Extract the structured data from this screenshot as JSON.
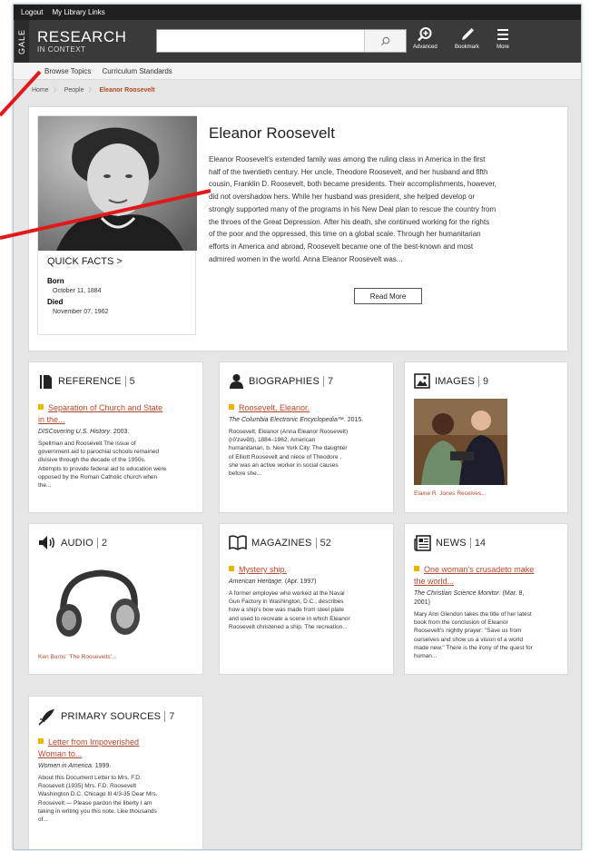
{
  "topbar": {
    "logout": "Logout",
    "library_links": "My Library Links"
  },
  "header": {
    "gale": "GALE",
    "brand_title": "RESEARCH",
    "brand_subtitle": "IN CONTEXT",
    "search_placeholder": "",
    "advanced": "Advanced",
    "bookmark": "Bookmark",
    "more": "More"
  },
  "subnav": {
    "browse": "Browse Topics",
    "standards": "Curriculum Standards"
  },
  "breadcrumb": {
    "home": "Home",
    "people": "People",
    "current": "Eleanor Roosevelt"
  },
  "hero": {
    "title": "Eleanor Roosevelt",
    "bio_lines": [
      "Eleanor Roosevelt's extended family was among the ruling class in America in the first",
      "half of the twentieth century. Her uncle, Theodore Roosevelt, and her husband and fifth",
      "cousin, Franklin D. Roosevelt, both became presidents. Their accomplishments, however,",
      "did not overshadow hers. While her husband was president, she helped develop or",
      "strongly supported many of the programs in his New Deal plan to rescue the country from",
      "the throes of the Great Depression. After his death, she continued working for the rights",
      "of the poor and the oppressed, this time on a global scale. Through her humanitarian",
      "efforts in America and abroad, Roosevelt became one of the best-known and most",
      "admired women in the world. Anna Eleanor Roosevelt was..."
    ],
    "read_more": "Read More",
    "quick_facts": "QUICK FACTS >",
    "born_label": "Born",
    "born_value": "October 11, 1884",
    "died_label": "Died",
    "died_value": "November 07, 1962"
  },
  "cards": {
    "reference": {
      "label": "REFERENCE",
      "count": "5",
      "link1": "Separation of Church and State",
      "link2": "in the...",
      "source_title": "DISCovering U.S. History",
      "source_rest": ". 2003.",
      "snippet": [
        "Spellman and Roosevelt The issue of",
        "government aid to parochial schools remained",
        "divisive through the decade of the 1950s.",
        "Attempts to provide federal aid to education were",
        "opposed by the Roman Catholic church when",
        "the..."
      ]
    },
    "biographies": {
      "label": "BIOGRAPHIES",
      "count": "7",
      "link1": "Roosevelt, Eleanor.",
      "source_title": "The Columbia Electronic Encyclopedia™",
      "source_rest": ". 2015.",
      "snippet": [
        "Roosevelt, Eleanor (Anna Eleanor Roosevelt)",
        "(rō'zəvĕlt), 1884–1962, American",
        "humanitarian, b. New York City. The daughter",
        "of Elliott Roosevelt and niece of Theodore ,",
        "she was an active worker in social causes",
        "before she..."
      ]
    },
    "images": {
      "label": "IMAGES",
      "count": "9",
      "caption": "Elaine R. Jones Receives..."
    },
    "audio": {
      "label": "AUDIO",
      "count": "2",
      "caption": "Ken Burns' 'The Roosevelts'..."
    },
    "magazines": {
      "label": "MAGAZINES",
      "count": "52",
      "link1": "Mystery ship.",
      "source_title": "American Heritage",
      "source_rest": ". (Apr. 1997)",
      "snippet": [
        "A former employee who worked at the Naval",
        "Gun Factory in Washington, D.C., describes",
        "how a ship's bow was made from steel plate",
        "and used to recreate a scene in which Eleanor",
        "Roosevelt christened a ship. The recreation..."
      ]
    },
    "news": {
      "label": "NEWS",
      "count": "14",
      "link1": "One woman's crusadeto make",
      "link2": "the world...",
      "source_title": "The Christian Science Monitor",
      "source_rest": ". (Mar. 8,",
      "source_rest2": "2001)",
      "snippet": [
        "Mary Ann Glendon takes the title of her latest",
        "book from the conclusion of Eleanor",
        "Roosevelt's nightly prayer: \"Save us from",
        "ourselves and show us a vision of a world",
        "made new.\" There is the irony of the quest for",
        "human..."
      ]
    },
    "primary": {
      "label": "PRIMARY SOURCES",
      "count": "7",
      "link1": "Letter from Impoverished",
      "link2": "Woman to...",
      "source_title": "Women in America",
      "source_rest": ". 1999.",
      "snippet": [
        "About this Document Letter to Mrs. F.D.",
        "Roosevelt (1935) Mrs. F.D. Roosevelt",
        "Washington D.C. Chicago Ill 4/3-35 Dear Mrs.",
        "Roosevelt:— Please pardon the liberty I am",
        "taking in writing you this note. Like thousands",
        "of..."
      ]
    }
  },
  "colors": {
    "accent_link": "#b5472c",
    "bullet": "#f0b400",
    "header_bg": "#3a3a3a",
    "annotation_arrow": "#e0191b"
  }
}
